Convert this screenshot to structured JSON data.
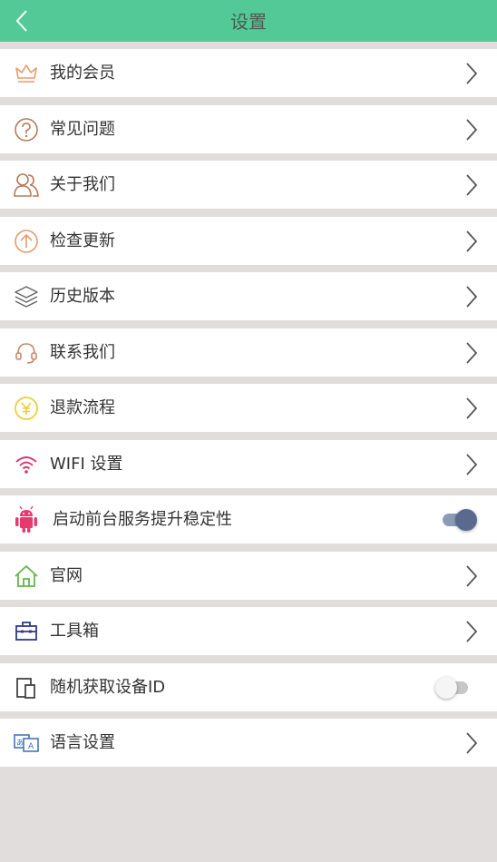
{
  "header": {
    "title": "设置"
  },
  "rows": [
    {
      "label": "我的会员"
    },
    {
      "label": "常见问题"
    },
    {
      "label": "关于我们"
    },
    {
      "label": "检查更新"
    },
    {
      "label": "历史版本"
    },
    {
      "label": "联系我们"
    },
    {
      "label": "退款流程"
    },
    {
      "label": "WIFI 设置"
    },
    {
      "label": "启动前台服务提升稳定性",
      "toggle": "on"
    },
    {
      "label": "官网"
    },
    {
      "label": "工具箱"
    },
    {
      "label": "随机获取设备ID",
      "toggle": "off"
    },
    {
      "label": "语言设置"
    }
  ],
  "colors": {
    "header_bg": "#52c996",
    "toggle_on_knob": "#5a6a8f",
    "toggle_on_track": "#8c9bb5",
    "page_bg": "#e0dddc"
  }
}
